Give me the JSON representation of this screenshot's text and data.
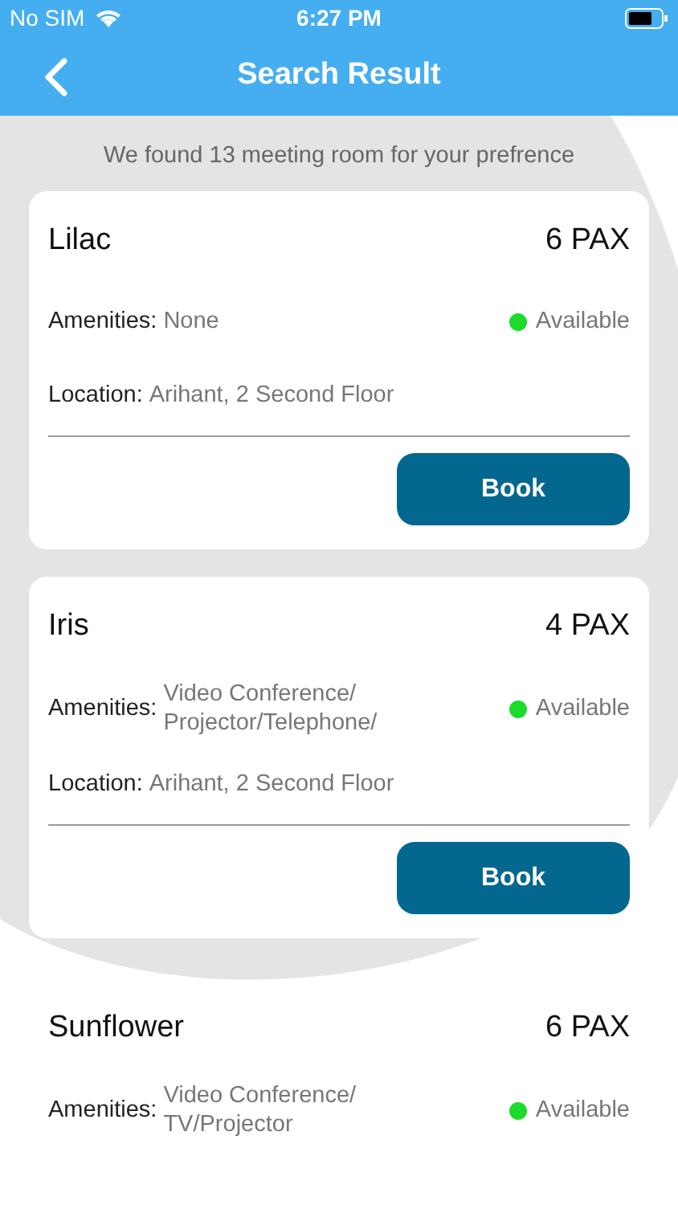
{
  "status_bar": {
    "carrier": "No SIM",
    "time": "6:27 PM"
  },
  "nav": {
    "title": "Search Result"
  },
  "summary": "We found 13 meeting room for your prefrence",
  "rooms": [
    {
      "name": "Lilac",
      "capacity": "6 PAX",
      "amenities_label": "Amenities:",
      "amenities": [
        "None"
      ],
      "available": true,
      "status": "Available",
      "location_label": "Location:",
      "location": "Arihant, 2 Second Floor",
      "button": "Book"
    },
    {
      "name": "Iris",
      "capacity": "4 PAX",
      "amenities_label": "Amenities:",
      "amenities": [
        "Video Conference/",
        "Projector/Telephone/"
      ],
      "available": true,
      "status": "Available",
      "location_label": "Location:",
      "location": "Arihant, 2 Second Floor",
      "button": "Book"
    },
    {
      "name": "Sunflower",
      "capacity": "6 PAX",
      "amenities_label": "Amenities:",
      "amenities": [
        "Video Conference/",
        "TV/Projector"
      ],
      "available": true,
      "status": "Available"
    }
  ]
}
